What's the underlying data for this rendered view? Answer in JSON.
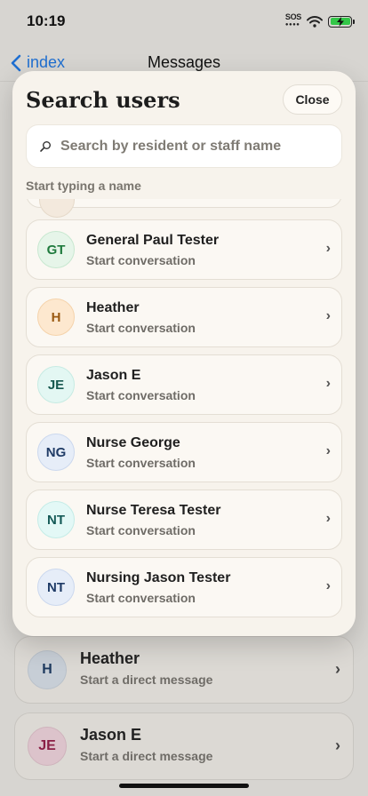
{
  "status": {
    "time": "10:19",
    "sos": "SOS"
  },
  "nav": {
    "back_label": "index",
    "title": "Messages"
  },
  "background_list": [
    {
      "initials": "H",
      "name": "Heather",
      "subtitle": "Start a direct message",
      "avatar_bg": "#c7ced6",
      "avatar_fg": "#1e3a5f"
    },
    {
      "initials": "JE",
      "name": "Jason E",
      "subtitle": "Start a direct message",
      "avatar_bg": "#dcc3cb",
      "avatar_fg": "#8a1f45"
    }
  ],
  "modal": {
    "title": "Search users",
    "close_label": "Close",
    "search_placeholder": "Search by resident or staff name",
    "hint": "Start typing a name",
    "action_label": "Start conversation",
    "users": [
      {
        "initials": "GT",
        "name": "General Paul Tester",
        "avatar_bg": "#e6f5e9",
        "avatar_fg": "#1f7a3d",
        "avatar_border": "#c8e8d0"
      },
      {
        "initials": "H",
        "name": "Heather",
        "avatar_bg": "#fde8cf",
        "avatar_fg": "#9a5a12",
        "avatar_border": "#f5d3ab"
      },
      {
        "initials": "JE",
        "name": "Jason E",
        "avatar_bg": "#e3f7f3",
        "avatar_fg": "#17584f",
        "avatar_border": "#c6ebe3"
      },
      {
        "initials": "NG",
        "name": "Nurse George",
        "avatar_bg": "#e6edf8",
        "avatar_fg": "#1f3b66",
        "avatar_border": "#cbd8ee"
      },
      {
        "initials": "NT",
        "name": "Nurse Teresa Tester",
        "avatar_bg": "#e3f8f6",
        "avatar_fg": "#155a57",
        "avatar_border": "#c4ece7"
      },
      {
        "initials": "NT",
        "name": "Nursing Jason Tester",
        "avatar_bg": "#e6edf8",
        "avatar_fg": "#1f3b66",
        "avatar_border": "#cbd8ee"
      }
    ]
  }
}
